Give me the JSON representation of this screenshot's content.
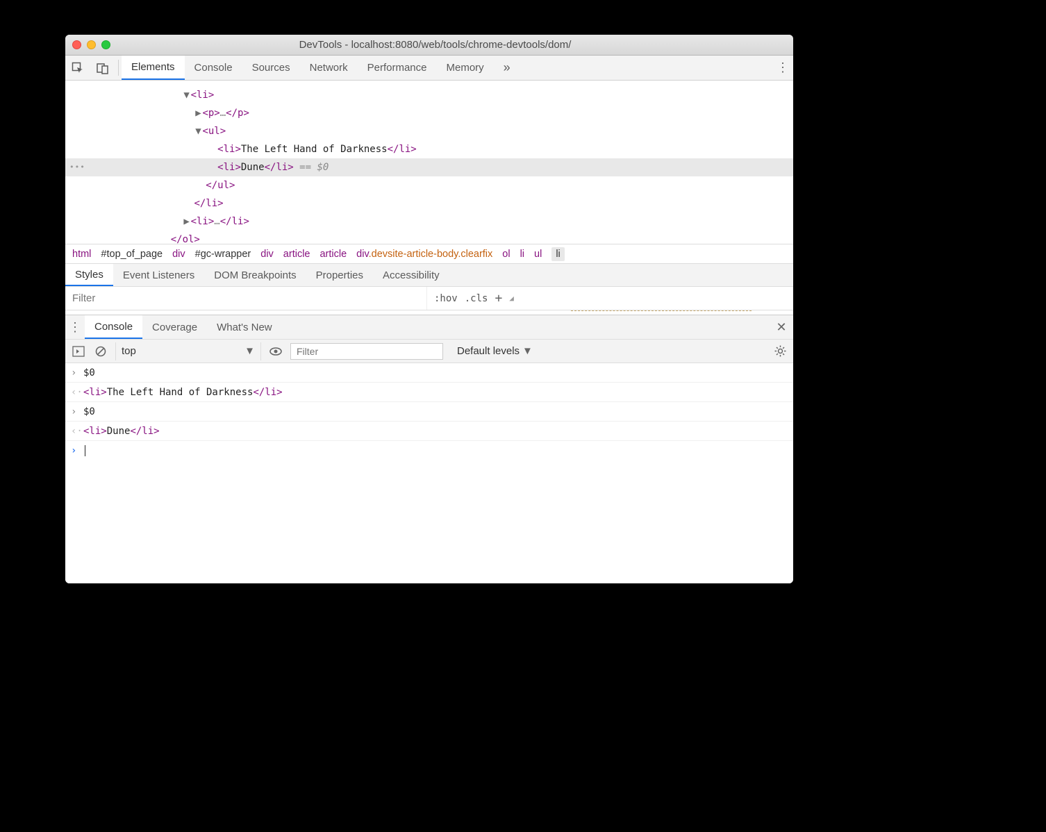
{
  "window": {
    "title": "DevTools - localhost:8080/web/tools/chrome-devtools/dom/"
  },
  "mainTabs": {
    "items": [
      "Elements",
      "Console",
      "Sources",
      "Network",
      "Performance",
      "Memory"
    ],
    "activeIndex": 0
  },
  "dom": {
    "l1_open": "<li>",
    "l2_p": "<p>",
    "l2_p_dots": "…",
    "l2_p_close": "</p>",
    "l3_ul": "<ul>",
    "l4a_open": "<li>",
    "l4a_text": "The Left Hand of Darkness",
    "l4a_close": "</li>",
    "l4b_open": "<li>",
    "l4b_text": "Dune",
    "l4b_close": "</li>",
    "l4b_eq": " == $0",
    "l3_ul_close": "</ul>",
    "l1_close": "</li>",
    "l5_open": "<li>",
    "l5_dots": "…",
    "l5_close": "</li>",
    "ol_close": "</ol>"
  },
  "breadcrumb": {
    "items": [
      {
        "t": "html",
        "cls": ""
      },
      {
        "t": "#top_of_page",
        "cls": "dark"
      },
      {
        "t": "div",
        "cls": ""
      },
      {
        "t": "#gc-wrapper",
        "cls": "dark"
      },
      {
        "t": "div",
        "cls": ""
      },
      {
        "t": "article",
        "cls": ""
      },
      {
        "t": "article",
        "cls": ""
      }
    ],
    "wide_tag": "div",
    "wide_attr": ".devsite-article-body.clearfix",
    "tail": [
      "ol",
      "li",
      "ul"
    ],
    "last": "li"
  },
  "subTabs": {
    "items": [
      "Styles",
      "Event Listeners",
      "DOM Breakpoints",
      "Properties",
      "Accessibility"
    ],
    "activeIndex": 0
  },
  "stylesToolbar": {
    "filterPlaceholder": "Filter",
    "hov": ":hov",
    "cls": ".cls"
  },
  "drawerTabs": {
    "items": [
      "Console",
      "Coverage",
      "What's New"
    ],
    "activeIndex": 0
  },
  "consoleToolbar": {
    "context": "top",
    "filterPlaceholder": "Filter",
    "levels": "Default levels"
  },
  "console": {
    "r1_in": "$0",
    "r1_out_open": "<li>",
    "r1_out_text": "The Left Hand of Darkness",
    "r1_out_close": "</li>",
    "r2_in": "$0",
    "r2_out_open": "<li>",
    "r2_out_text": "Dune",
    "r2_out_close": "</li>"
  }
}
